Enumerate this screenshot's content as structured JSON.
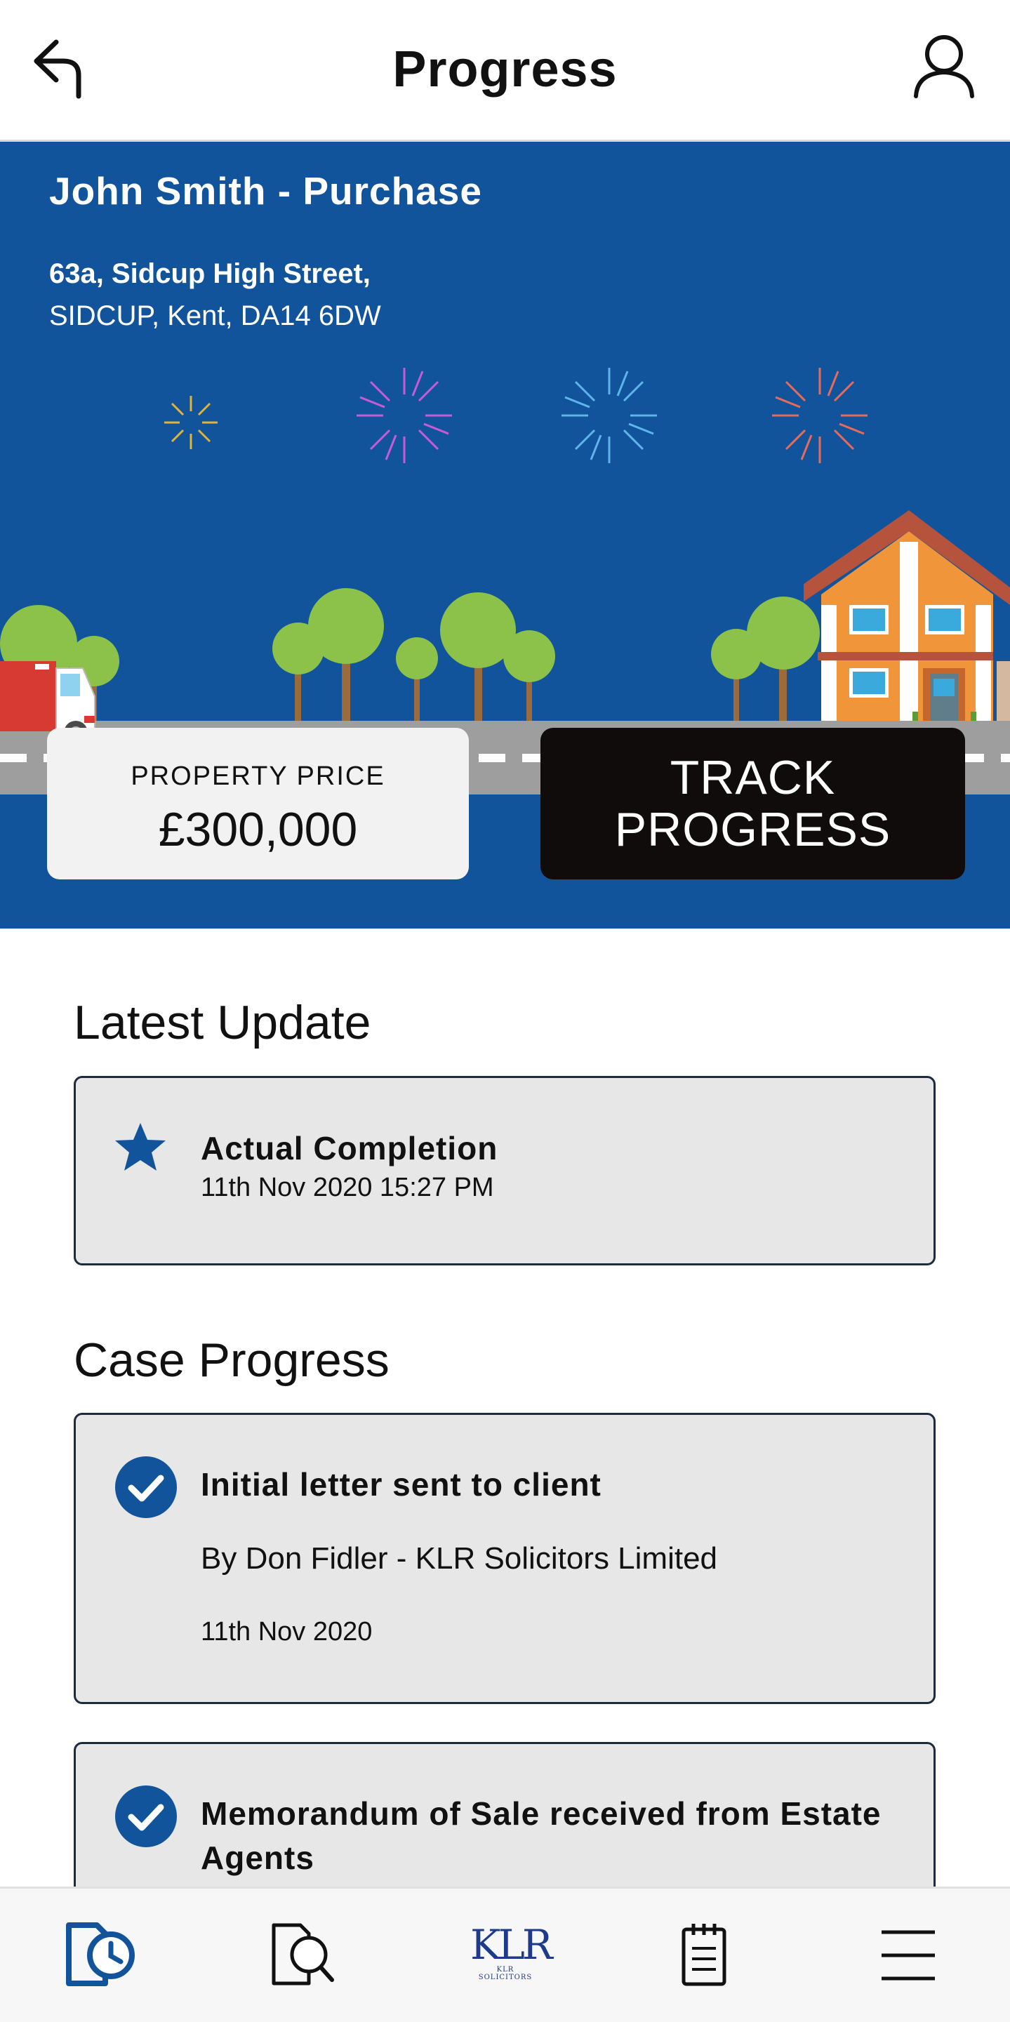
{
  "header": {
    "title": "Progress",
    "back_icon": "back-arrow-icon",
    "profile_icon": "user-icon"
  },
  "case": {
    "title": "John Smith - Purchase",
    "address_line1": "63a, Sidcup High Street,",
    "address_line2": "SIDCUP, Kent, DA14 6DW"
  },
  "price": {
    "label": "PROPERTY PRICE",
    "value": "£300,000"
  },
  "track_button": {
    "line1": "TRACK",
    "line2": "PROGRESS"
  },
  "latest_update": {
    "heading": "Latest Update",
    "title": "Actual Completion",
    "date": "11th Nov 2020 15:27 PM",
    "icon": "star-icon"
  },
  "case_progress": {
    "heading": "Case Progress",
    "items": [
      {
        "title": "Initial letter sent to client",
        "subtitle": "By Don Fidler - KLR Solicitors Limited",
        "date": "11th Nov 2020",
        "icon": "check-circle-icon"
      },
      {
        "title_line1": "Memorandum of Sale received from Estate",
        "title_line2": "Agents",
        "icon": "check-circle-icon"
      }
    ]
  },
  "bottom_nav": {
    "items": [
      "progress-clock-icon",
      "document-search-icon",
      "klr-logo",
      "notepad-icon",
      "menu-icon"
    ],
    "logo_text": "KLR",
    "logo_subtext": "KLR SOLICITORS"
  },
  "colors": {
    "brand_blue": "#11549b",
    "dark_button": "#0f0c0b",
    "card_grey": "#e7e7e7",
    "road_grey": "#9e9e9e"
  }
}
